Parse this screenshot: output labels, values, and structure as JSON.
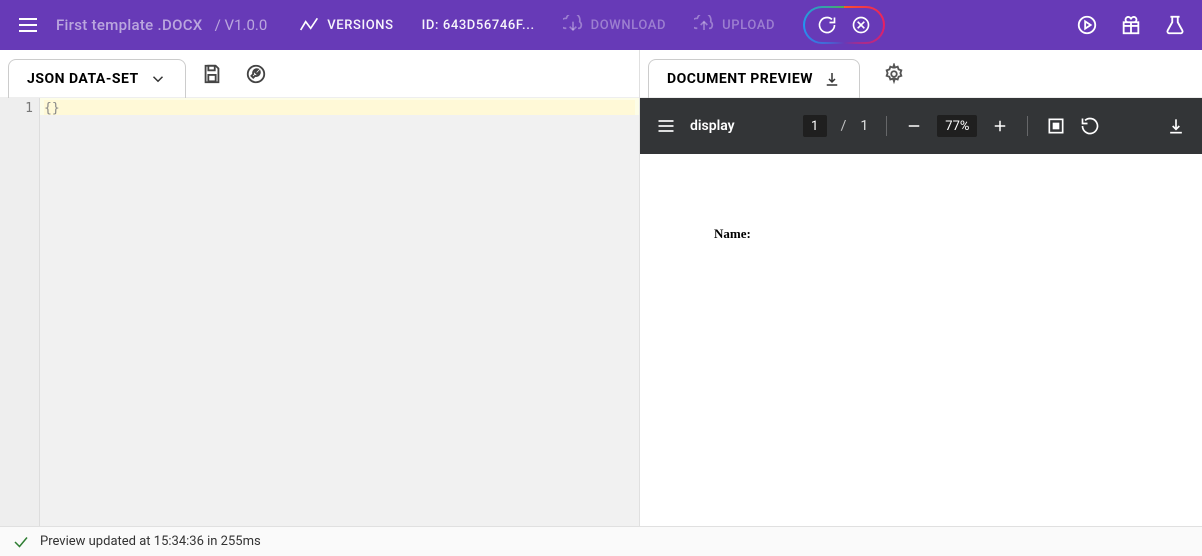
{
  "header": {
    "title": "First template .DOCX",
    "version_prefix": "/ ",
    "version": "V1.0.0",
    "versions_label": "VERSIONS",
    "id_label": "ID: 643D56746F...",
    "download_label": "DOWNLOAD",
    "upload_label": "UPLOAD"
  },
  "left": {
    "tab_label": "JSON DATA-SET",
    "line_number": "1",
    "code_line": "{}"
  },
  "right": {
    "tab_label": "DOCUMENT PREVIEW"
  },
  "pdf": {
    "title": "display",
    "page_current": "1",
    "page_sep": "/",
    "page_total": "1",
    "zoom": "77%"
  },
  "doc": {
    "line1": "Name:"
  },
  "status": {
    "message": "Preview updated at 15:34:36 in 255ms"
  }
}
